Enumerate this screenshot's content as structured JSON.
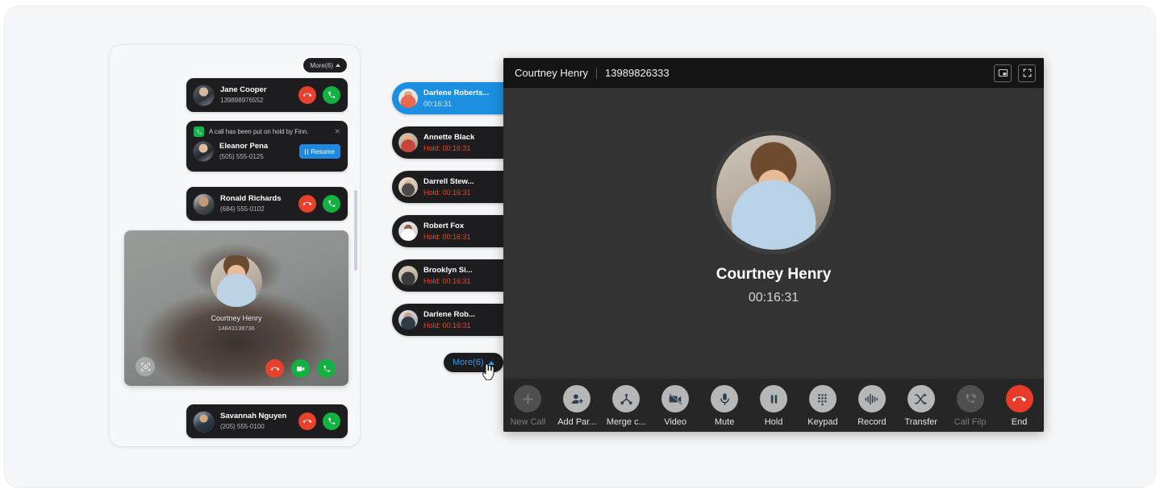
{
  "left_panel": {
    "more_button": {
      "label": "More(6)",
      "icon": "chevron-up-icon"
    },
    "cards": [
      {
        "name": "Jane Cooper",
        "number": "139898976552"
      },
      {
        "name": "Ronald Richards",
        "number": "(684) 555-0102"
      },
      {
        "name": "Savannah Nguyen",
        "number": "(205) 555-0100"
      }
    ],
    "hold_notification": {
      "icon": "phone-icon",
      "message": "A call has been put on hold by Finn.",
      "close_icon": "close-icon",
      "name": "Eleanor Pena",
      "number": "(505) 555-0125",
      "resume_label": "Resume",
      "resume_icon": "pause-icon"
    },
    "video_card": {
      "name": "Courtney Henry",
      "number": "14843138736",
      "face_icon": "face-detect-icon",
      "controls": [
        {
          "icon": "hangup-icon",
          "color": "#e8412c"
        },
        {
          "icon": "video-camera-icon",
          "color": "#12b141"
        },
        {
          "icon": "phone-answer-icon",
          "color": "#12b141"
        }
      ]
    }
  },
  "mid_list": {
    "items": [
      {
        "name": "Darlene Roberts...",
        "status": "00:16:31",
        "on_hold": false,
        "active": true
      },
      {
        "name": "Annette Black",
        "status": "Hold: 00:16:31",
        "on_hold": true,
        "active": false
      },
      {
        "name": "Darrell Stew...",
        "status": "Hold: 00:16:31",
        "on_hold": true,
        "active": false
      },
      {
        "name": "Robert Fox",
        "status": "Hold: 00:16:31",
        "on_hold": true,
        "active": false
      },
      {
        "name": "Brooklyn Si...",
        "status": "Hold: 00:16:31",
        "on_hold": true,
        "active": false
      },
      {
        "name": "Darlene Rob...",
        "status": "Hold: 00:16:31",
        "on_hold": true,
        "active": false
      }
    ],
    "more_button": {
      "label": "More(6)",
      "icon": "chevron-up-icon",
      "color": "#2f9ae8"
    }
  },
  "call_window": {
    "title": {
      "name": "Courtney Henry",
      "number": "13989826333"
    },
    "window_buttons": [
      {
        "icon": "picture-in-picture-icon"
      },
      {
        "icon": "fullscreen-icon"
      }
    ],
    "hero": {
      "name": "Courtney Henry",
      "timer": "00:16:31"
    },
    "toolbar": [
      {
        "label": "New Call",
        "icon": "plus-icon",
        "disabled": true
      },
      {
        "label": "Add Par...",
        "icon": "add-participant-icon",
        "disabled": false
      },
      {
        "label": "Merge c...",
        "icon": "merge-call-icon",
        "disabled": false
      },
      {
        "label": "Video",
        "icon": "video-off-icon",
        "disabled": false
      },
      {
        "label": "Mute",
        "icon": "microphone-icon",
        "disabled": false
      },
      {
        "label": "Hold",
        "icon": "pause-icon",
        "disabled": false
      },
      {
        "label": "Keypad",
        "icon": "keypad-icon",
        "disabled": false
      },
      {
        "label": "Record",
        "icon": "record-waveform-icon",
        "disabled": false
      },
      {
        "label": "Transfer",
        "icon": "transfer-shuffle-icon",
        "disabled": false
      },
      {
        "label": "Call Filp",
        "icon": "call-flip-icon",
        "disabled": true
      },
      {
        "label": "End",
        "icon": "hangup-icon",
        "disabled": false,
        "end": true
      }
    ]
  },
  "colors": {
    "accent_blue": "#1d8fe0",
    "hold_red": "#e8492b",
    "hangup_red": "#e8412c",
    "answer_green": "#12b141",
    "card_dark": "#1d1d1f",
    "window_dark": "#2e2e2e",
    "page_bg": "#f4f6f8"
  }
}
